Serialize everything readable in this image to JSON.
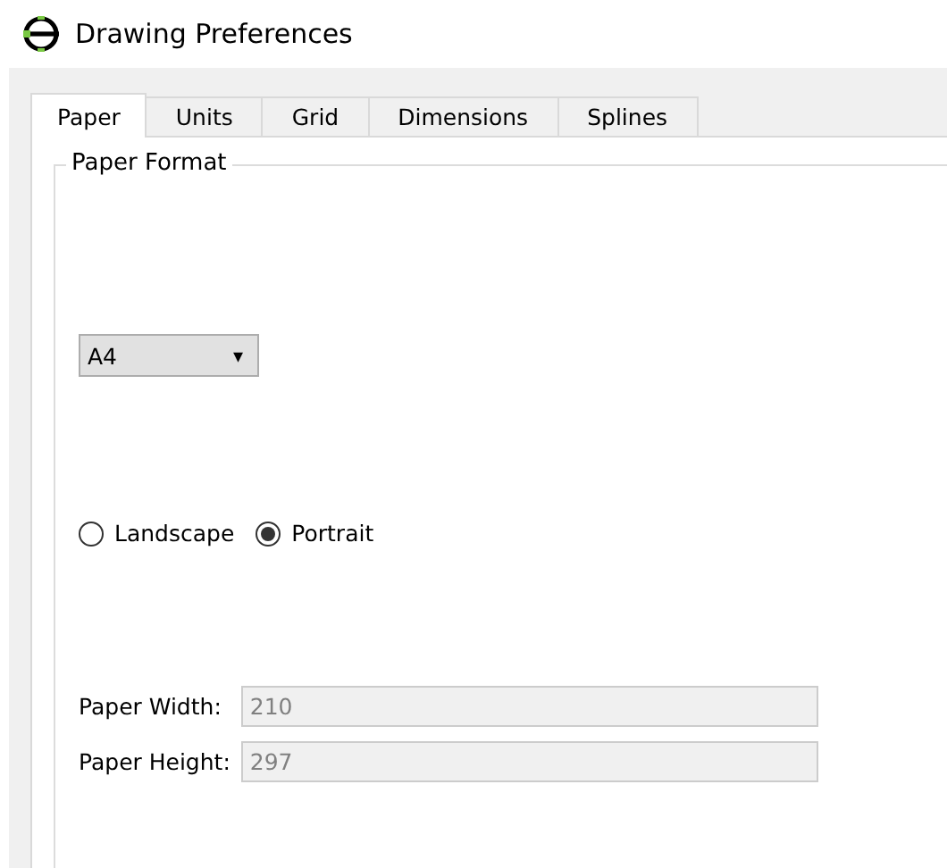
{
  "window": {
    "title": "Drawing Preferences"
  },
  "tabs": [
    {
      "label": "Paper",
      "selected": true
    },
    {
      "label": "Units",
      "selected": false
    },
    {
      "label": "Grid",
      "selected": false
    },
    {
      "label": "Dimensions",
      "selected": false
    },
    {
      "label": "Splines",
      "selected": false
    }
  ],
  "group": {
    "title": "Paper Format"
  },
  "format": {
    "value": "A4",
    "caret": "▾"
  },
  "orientation": [
    {
      "label": "Landscape",
      "selected": false
    },
    {
      "label": "Portrait",
      "selected": true
    }
  ],
  "fields": [
    {
      "label": "Paper Width:",
      "value": "210",
      "disabled": true
    },
    {
      "label": "Paper Height:",
      "value": "297",
      "disabled": true
    }
  ]
}
